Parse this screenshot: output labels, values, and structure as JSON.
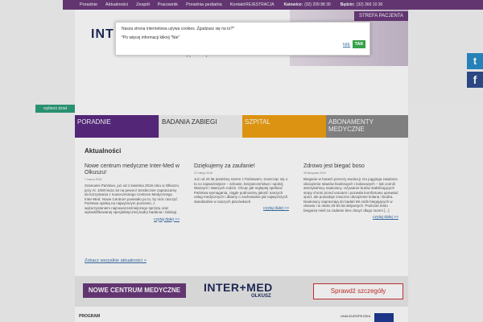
{
  "nav": {
    "home_icon": "home-icon",
    "items": [
      "Poradnie",
      "Aktualności",
      "Zespół",
      "Pracownik",
      "Poradnia pediatria",
      "Kontakt"
    ],
    "registration_label": "REJESTRACJA",
    "katowice_label": "Katowice:",
    "katowice_phone": "(32) 209 88 30",
    "bedzin_label": "Będzin:",
    "bedzin_phone": "(32) 360 10 30",
    "strefa_label": "STREFA PACJENTA"
  },
  "header": {
    "logo_fragment": "INT",
    "tagline": "i Twoją rodzinę!"
  },
  "cookie": {
    "message": "Nasza strona internetowa używa cookies. Zgadzasz się na to?*",
    "more_info": "*Po więcej informacji kliknij \"Nie\"",
    "no_label": "NIE",
    "yes_label": "TAK"
  },
  "social": {
    "twitter_glyph": "t",
    "facebook_glyph": "f"
  },
  "wybierz_label": "wybierz dział",
  "tabs": [
    {
      "label": "PORADNIE"
    },
    {
      "label": "BADANIA ZABIEGI"
    },
    {
      "label": "SZPITAL"
    },
    {
      "label": "ABONAMENTY MEDYCZNE"
    }
  ],
  "news": {
    "heading": "Aktualności",
    "columns": [
      {
        "title": "Nowe centrum medyczne Inter-Med w Olkuszu!",
        "date": "7 marca 2016",
        "body": "Szanowni Państwo, już od 1 kwietnia 2016 roku w Olkuszu przy Al. 1000-lecia 16 na pewno! Serdecznie zapraszamy do korzystania z nowoczesnego Centrum Medycznego Inter-Med. Nowe Centrum powstało po to, by móc otoczyć Państwa opieką na najwyższym poziomie, z wykorzystaniem najnowocześniejszego sprzętu oraz wykwalifikowanej specjalistycznej kadry badania i zabiegi.",
        "more": "czytaj dalej >>"
      },
      {
        "title": "Dziękujemy za zaufanie!",
        "date": "22 lutego 2016",
        "body": "Już od 20 lat jesteśmy razem z Państwem, troszcząc się o to co najważniejsze – zdrowie, bezpieczeństwo i spokój Waszym i Waszych rodzin. Chcąc jak najlepiej spełniać Państwa wymagania, ciągle podnosimy jakość naszych usług medycznych i dbamy o zachowanie jak najwyższych standardów w naszych placówkach.",
        "more": "czytaj dalej >>"
      },
      {
        "title": "Zdrowo jest biegać boso",
        "date": "28 listopada 2015",
        "body": "Bieganie w butach przeczy ewolucji. Do jogginga zwiększa obciążenie stawów biodrowych i kolanowych – tak ocenili amerykańscy naukowcy. Używanie butów stabilizujących stopy chroni przed urazami i pozwala komfortowo uprawiać sport, ale powoduje znaczne obciążenie kolana i biodra. Naukowcy zapraszają do badań 68 osób biegających w obuwiu i w około 20-50 lat aktywnych. Podczas testu biegania mieli za zadanie biec dosyć długo razem [...]",
        "more": "czytaj dalej >>"
      }
    ],
    "all_link": "Zobacz wszystkie aktualności >"
  },
  "banner": {
    "left": "NOWE CENTRUM MEDYCZNE",
    "brand": "INTER+MED",
    "brand_sub": "OLKUSZ",
    "cta": "Sprawdź szczegóły"
  },
  "footer": {
    "program": "PROGRAM",
    "ue": "UNIA EUROPEJSKA"
  },
  "colors": {
    "purple": "#6b3a7b",
    "orange": "#f0a014",
    "green": "#35a148",
    "twitter": "#2a8dc8",
    "facebook": "#2f4f8f"
  }
}
